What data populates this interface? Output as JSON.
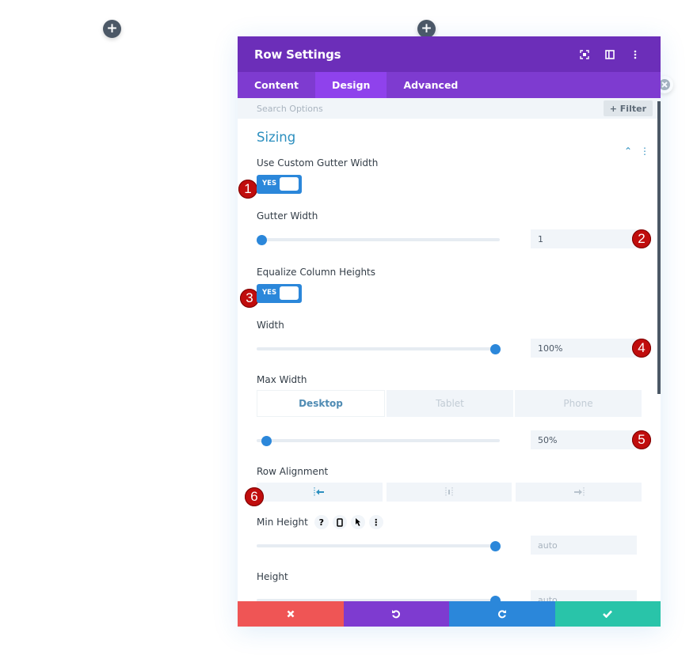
{
  "canvas": {
    "add_buttons": [
      {
        "icon": "plus-icon"
      },
      {
        "icon": "plus-icon"
      }
    ]
  },
  "modal": {
    "title": "Row Settings",
    "header_icons": [
      "expand-icon",
      "split-view-icon",
      "more-vertical-icon"
    ],
    "tabs": [
      {
        "label": "Content",
        "active": false
      },
      {
        "label": "Design",
        "active": true
      },
      {
        "label": "Advanced",
        "active": false
      }
    ],
    "search": {
      "placeholder": "Search Options",
      "filter_label": "+ Filter"
    },
    "section": {
      "title": "Sizing",
      "fields": {
        "custom_gutter": {
          "label": "Use Custom Gutter Width",
          "value": "YES",
          "badge": "1"
        },
        "gutter_width": {
          "label": "Gutter Width",
          "value": "1",
          "slider_fraction": 0.0,
          "badge": "2"
        },
        "equalize": {
          "label": "Equalize Column Heights",
          "value": "YES",
          "badge": "3"
        },
        "width": {
          "label": "Width",
          "value": "100%",
          "slider_fraction": 1.0,
          "badge": "4"
        },
        "max_width": {
          "label": "Max Width",
          "devices": [
            {
              "label": "Desktop",
              "active": true
            },
            {
              "label": "Tablet",
              "active": false
            },
            {
              "label": "Phone",
              "active": false
            }
          ],
          "value": "50%",
          "slider_fraction": 0.02,
          "badge": "5"
        },
        "row_alignment": {
          "label": "Row Alignment",
          "options": [
            {
              "icon": "align-left-icon",
              "active": true
            },
            {
              "icon": "align-center-icon",
              "active": false
            },
            {
              "icon": "align-right-icon",
              "active": false
            }
          ],
          "badge": "6"
        },
        "min_height": {
          "label": "Min Height",
          "value": "auto",
          "slider_fraction": 1.0,
          "help_icons": [
            "?",
            "tablet-icon",
            "cursor-icon",
            "more-vertical-icon"
          ]
        },
        "height": {
          "label": "Height",
          "value": "auto",
          "slider_fraction": 1.0
        }
      }
    },
    "footer": [
      {
        "action": "cancel",
        "icon": "close-icon",
        "color": "#ef5555"
      },
      {
        "action": "undo",
        "icon": "undo-icon",
        "color": "#7e3bd0"
      },
      {
        "action": "redo",
        "icon": "redo-icon",
        "color": "#2b87da"
      },
      {
        "action": "save",
        "icon": "check-icon",
        "color": "#29c4a9"
      }
    ]
  },
  "colors": {
    "header": "#6c2eb9",
    "tabs": "#7e3bd0",
    "accent": "#2b87da",
    "badge": "#c00d0d"
  }
}
